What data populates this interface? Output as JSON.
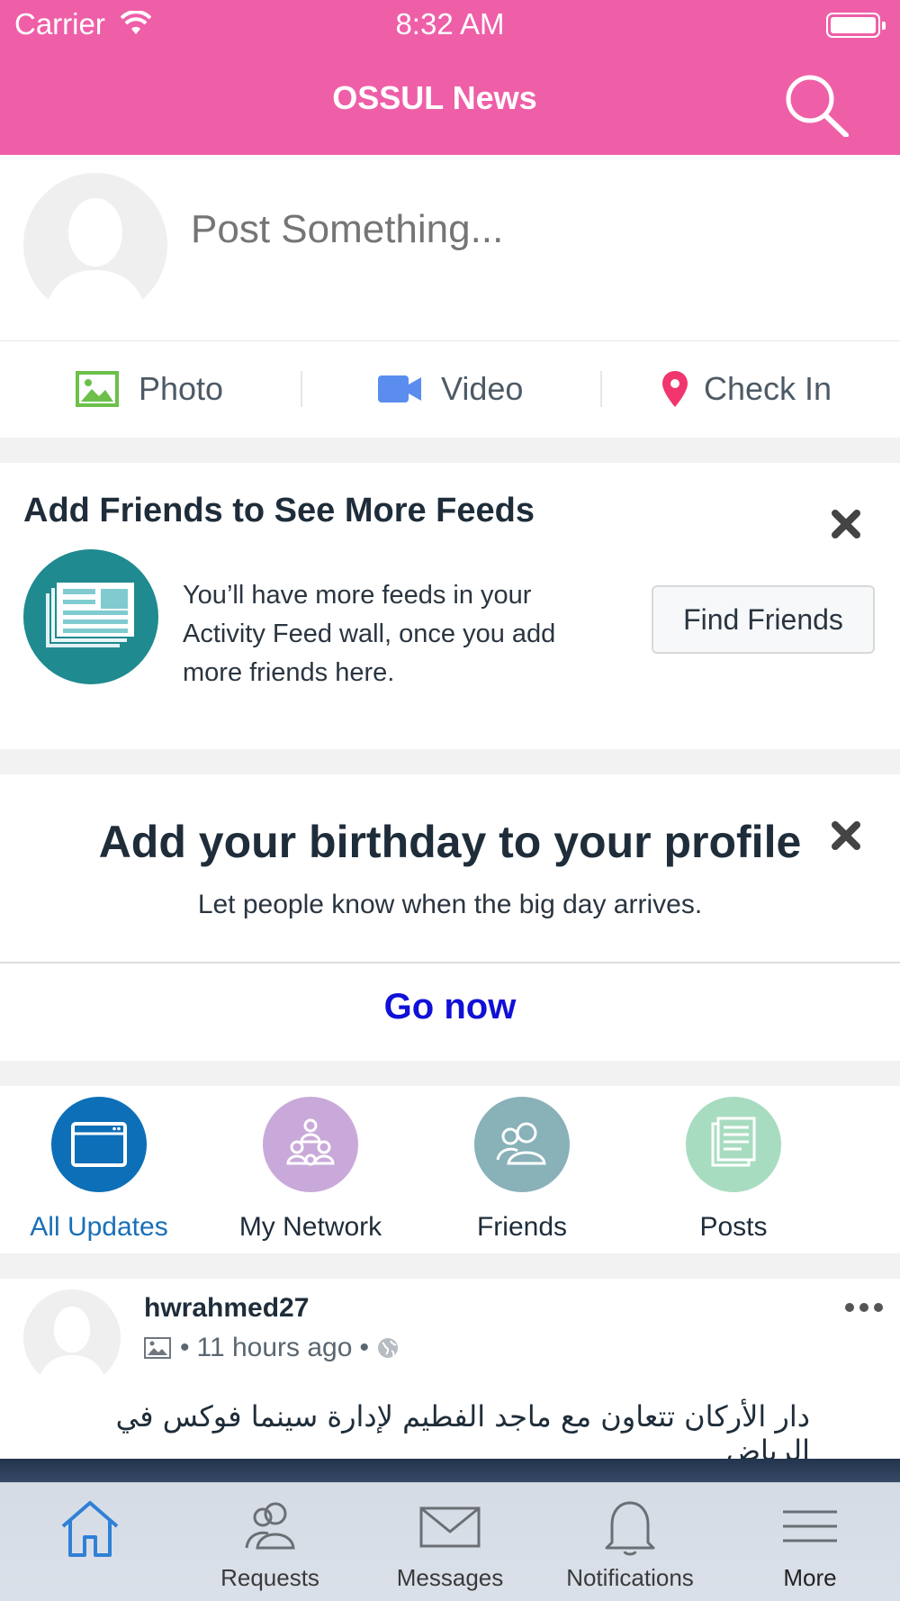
{
  "status_bar": {
    "carrier": "Carrier",
    "time": "8:32 AM"
  },
  "nav": {
    "title": "OSSUL News",
    "search_icon": "search-icon"
  },
  "colors": {
    "brand": "#ee5fa8",
    "link": "#1010d8",
    "active_tab": "#2f80d6",
    "feed_badge": "#1f8a8f"
  },
  "composer": {
    "placeholder": "Post Something...",
    "actions": [
      {
        "label": "Photo",
        "icon": "photo-icon",
        "color": "#6cc04a"
      },
      {
        "label": "Video",
        "icon": "video-camera-icon",
        "color": "#5b8def"
      },
      {
        "label": "Check In",
        "icon": "location-pin-icon",
        "color": "#f0366c"
      }
    ]
  },
  "friends_card": {
    "title": "Add Friends to See More Feeds",
    "body": "You’ll have more feeds in your Activity Feed wall, once you add more friends here.",
    "button": "Find Friends"
  },
  "birthday_card": {
    "title": "Add your birthday to your profile",
    "subtitle": "Let people know when the big day arrives.",
    "link": "Go now"
  },
  "filters": [
    {
      "label": "All Updates",
      "color": "#0d6fb8",
      "active": true
    },
    {
      "label": "My Network",
      "color": "#c9a9d9",
      "active": false
    },
    {
      "label": "Friends",
      "color": "#88b1b8",
      "active": false
    },
    {
      "label": "Posts",
      "color": "#a8dcc0",
      "active": false
    }
  ],
  "post": {
    "username": "hwrahmed27",
    "time": "11 hours ago",
    "text": "دار الأركان تتعاون مع ماجد الفطيم لإدارة سينما فوكس في الرياض"
  },
  "tabbar": [
    {
      "label": "",
      "icon": "home-icon",
      "active": true
    },
    {
      "label": "Requests",
      "icon": "people-icon",
      "active": false
    },
    {
      "label": "Messages",
      "icon": "envelope-icon",
      "active": false
    },
    {
      "label": "Notifications",
      "icon": "bell-icon",
      "active": false
    },
    {
      "label": "More",
      "icon": "menu-icon",
      "active": false
    }
  ]
}
